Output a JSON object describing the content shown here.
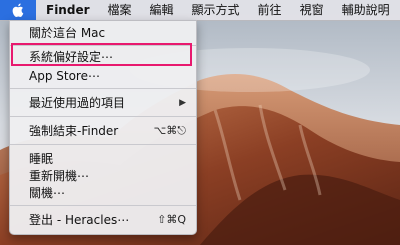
{
  "menubar": {
    "items": [
      "Finder",
      "檔案",
      "編輯",
      "顯示方式",
      "前往",
      "視窗",
      "輔助說明"
    ]
  },
  "apple_menu": {
    "about": "關於這台 Mac",
    "system_prefs": "系統偏好設定⋯",
    "app_store": "App Store⋯",
    "recent": "最近使用過的項目",
    "force_quit": "強制結束-Finder",
    "force_quit_shortcut": "⌥⌘⎋",
    "sleep": "睡眠",
    "restart": "重新開機⋯",
    "shutdown": "關機⋯",
    "logout": "登出 - Heracles⋯",
    "logout_shortcut": "⇧⌘Q"
  },
  "colors": {
    "apple_highlight": "#2b6fe0",
    "annotation_box": "#e8196e"
  }
}
